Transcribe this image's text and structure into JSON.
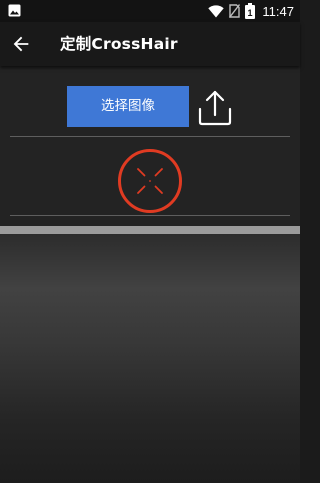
{
  "status_bar": {
    "time": "11:47",
    "battery_text": "1",
    "icons": [
      "image-notification-icon",
      "wifi-icon",
      "no-sim-icon",
      "battery-icon"
    ]
  },
  "toolbar": {
    "title": "定制CrossHair",
    "back_icon": "arrow-back-icon"
  },
  "main": {
    "choose_image_label": "选择图像",
    "upload_icon": "upload-icon",
    "crosshair_icon": "crosshair-preview",
    "colors": {
      "button": "#3f78d6",
      "crosshair": "#e03b22"
    }
  }
}
